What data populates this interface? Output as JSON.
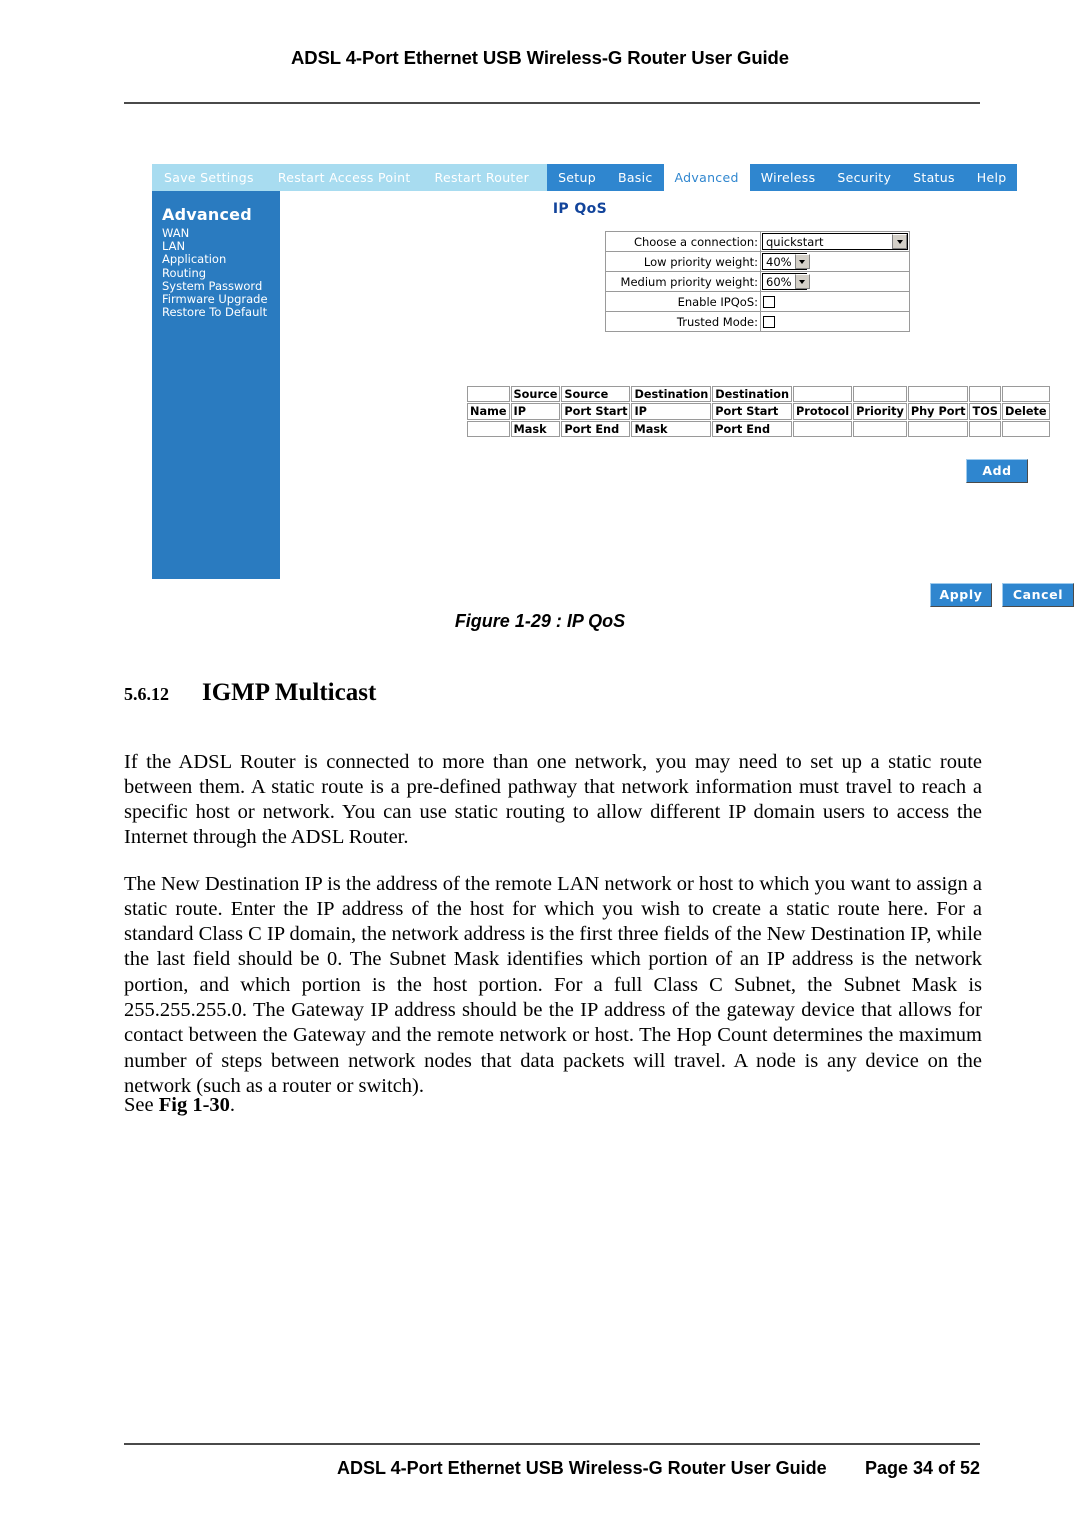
{
  "document": {
    "header_title": "ADSL 4-Port Ethernet USB Wireless-G Router User Guide",
    "footer_title": "ADSL 4-Port Ethernet USB Wireless-G Router User Guide",
    "footer_page": "Page 34 of 52"
  },
  "figure": {
    "caption": "Figure 1-29 : IP QoS"
  },
  "router_ui": {
    "top_actions": [
      {
        "label": "Save Settings"
      },
      {
        "label": "Restart Access Point"
      },
      {
        "label": "Restart Router"
      }
    ],
    "tabs": [
      {
        "label": "Setup",
        "active": false
      },
      {
        "label": "Basic",
        "active": false
      },
      {
        "label": "Advanced",
        "active": true
      },
      {
        "label": "Wireless",
        "active": false
      },
      {
        "label": "Security",
        "active": false
      },
      {
        "label": "Status",
        "active": false
      },
      {
        "label": "Help",
        "active": false
      }
    ],
    "sidebar": {
      "title": "Advanced",
      "items": [
        {
          "label": "WAN"
        },
        {
          "label": "LAN"
        },
        {
          "label": "Application"
        },
        {
          "label": "Routing"
        },
        {
          "label": "System Password"
        },
        {
          "label": "Firmware Upgrade"
        },
        {
          "label": "Restore To Default"
        }
      ]
    },
    "panel": {
      "title": "IP QoS",
      "fields": [
        {
          "label": "Choose a connection:",
          "type": "select",
          "value": "quickstart"
        },
        {
          "label": "Low priority weight:",
          "type": "select",
          "value": "40%"
        },
        {
          "label": "Medium priority weight:",
          "type": "select",
          "value": "60%"
        },
        {
          "label": "Enable IPQoS:",
          "type": "checkbox",
          "value": ""
        },
        {
          "label": "Trusted Mode:",
          "type": "checkbox",
          "value": ""
        }
      ]
    },
    "rules_table": {
      "columns": [
        {
          "top": "",
          "mid": "Name",
          "bot": ""
        },
        {
          "top": "Source",
          "mid": "IP",
          "bot": "Mask"
        },
        {
          "top": "Source",
          "mid": "Port Start",
          "bot": "Port End"
        },
        {
          "top": "Destination",
          "mid": "IP",
          "bot": "Mask"
        },
        {
          "top": "Destination",
          "mid": "Port Start",
          "bot": "Port End"
        },
        {
          "top": "",
          "mid": "Protocol",
          "bot": ""
        },
        {
          "top": "",
          "mid": "Priority",
          "bot": ""
        },
        {
          "top": "",
          "mid": "Phy Port",
          "bot": ""
        },
        {
          "top": "",
          "mid": "TOS",
          "bot": ""
        },
        {
          "top": "",
          "mid": "Delete",
          "bot": ""
        }
      ],
      "rows": []
    },
    "buttons": {
      "add": "Add",
      "apply": "Apply",
      "cancel": "Cancel"
    },
    "colors": {
      "navbar_bg": "#a8dcf0",
      "tab_bg": "#2f86cf",
      "tab_active_bg": "#ffffff",
      "sidebar_bg": "#2a7bc0",
      "panel_title": "#12449b",
      "button_bg": "#2f86cf"
    }
  },
  "section": {
    "number": "5.6.12",
    "title": "IGMP Multicast",
    "paragraph_1": "If the ADSL Router is connected to more than one network, you may need to set up a static route between them. A static route is a pre-defined pathway that network information must travel to reach a specific host or network. You can use static routing to allow different IP domain users to access the Internet through the ADSL Router.",
    "paragraph_2": "The New Destination IP is the address of the remote LAN network or host to which you want to assign a static route. Enter the IP address of the host for which you wish to create a static route here. For a standard Class C IP domain, the network address is the first three fields of the New Destination IP, while the last field should be 0.  The Subnet Mask identifies which portion of an IP address is the network portion, and which portion is the host portion. For a full Class C Subnet, the Subnet Mask is 255.255.255.0.  The Gateway IP address should be the IP address of the gateway device that allows for contact between the Gateway and the remote network or host. The Hop Count determines the maximum number of steps between network nodes that data packets will travel. A node is any device on the network (such as a router or switch).",
    "see_fig_prefix": "See ",
    "see_fig_ref": "Fig 1-30",
    "see_fig_suffix": "."
  }
}
